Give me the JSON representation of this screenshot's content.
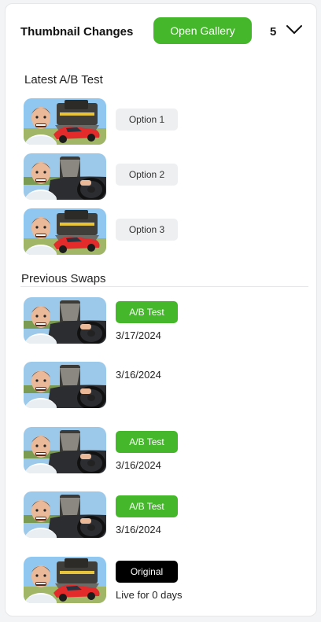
{
  "header": {
    "title": "Thumbnail Changes",
    "open_gallery_label": "Open Gallery",
    "count": "5",
    "expand_icon": "chevron-down-icon"
  },
  "latest": {
    "heading": "Latest A/B Test",
    "options": [
      {
        "label": "Option 1",
        "thumb": "train-car"
      },
      {
        "label": "Option 2",
        "thumb": "car-driver"
      },
      {
        "label": "Option 3",
        "thumb": "train-car"
      }
    ]
  },
  "previous": {
    "heading": "Previous Swaps",
    "items": [
      {
        "badge": "A/B Test",
        "date": "3/17/2024",
        "thumb": "car-driver"
      },
      {
        "badge": "",
        "date": "3/16/2024",
        "thumb": "car-driver"
      },
      {
        "badge": "A/B Test",
        "date": "3/16/2024",
        "thumb": "car-driver"
      },
      {
        "badge": "A/B Test",
        "date": "3/16/2024",
        "thumb": "car-driver"
      },
      {
        "badge": "Original",
        "date": "Live for 0 days",
        "thumb": "train-car"
      }
    ]
  },
  "colors": {
    "accent": "#45b72b",
    "badge_original": "#000000",
    "pill_gray": "#eeeff1"
  }
}
